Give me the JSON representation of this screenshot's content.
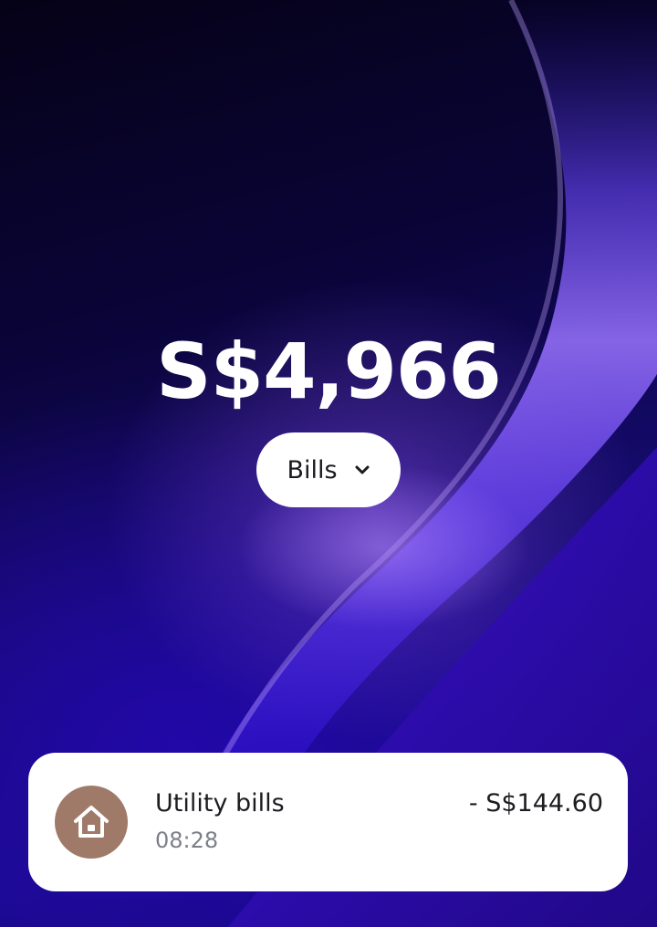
{
  "balance": {
    "amount": "S$4,966"
  },
  "category_selector": {
    "label": "Bills",
    "icon": "chevron-down-icon"
  },
  "transaction": {
    "title": "Utility bills",
    "time": "08:28",
    "amount": "- S$144.60",
    "icon": "home-icon",
    "icon_bg_color": "#a07a69"
  },
  "colors": {
    "background_dark": "#07042a",
    "accent_violet": "#7a4df0",
    "card_bg": "#ffffff",
    "pill_bg": "#ffffff"
  }
}
